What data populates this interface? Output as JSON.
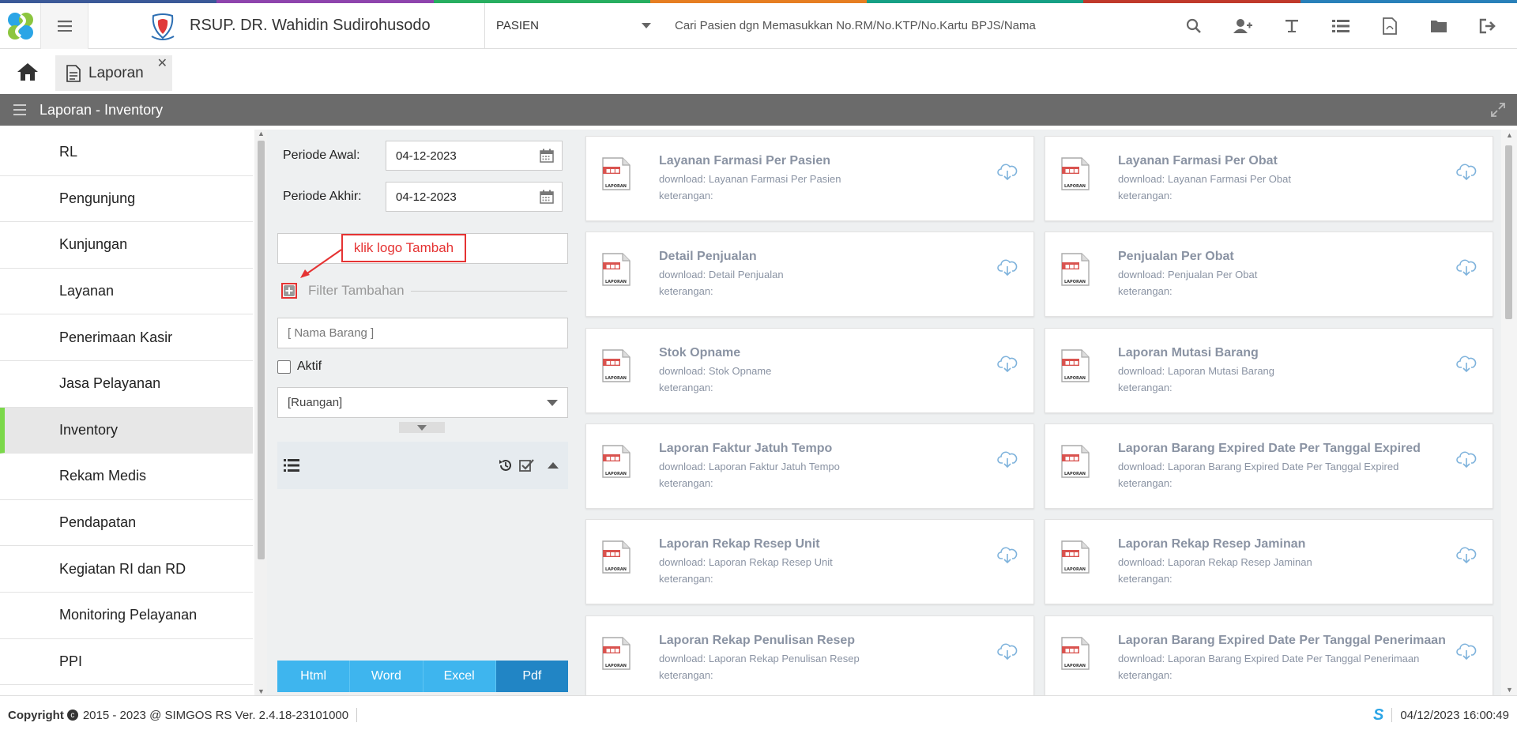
{
  "colors": {
    "accent": "#2185c5",
    "export_btn": "#3eb5ee",
    "titlebar": "#6b6b6b",
    "annotation": "#e53333",
    "active_indicator": "#7bd84a"
  },
  "header": {
    "hospital_name": "RSUP. DR. Wahidin Sudirohusodo",
    "patient_type": "PASIEN",
    "search_placeholder": "Cari Pasien dgn Memasukkan No.RM/No.KTP/No.Kartu BPJS/Nama",
    "icons": [
      "search-icon",
      "add-user-icon",
      "text-icon",
      "list-icon",
      "pdf-file-icon",
      "folder-icon",
      "logout-icon"
    ]
  },
  "tabs": {
    "active_label": "Laporan"
  },
  "titlebar": {
    "title": "Laporan - Inventory"
  },
  "sidebar": {
    "items": [
      {
        "label": "RL"
      },
      {
        "label": "Pengunjung"
      },
      {
        "label": "Kunjungan"
      },
      {
        "label": "Layanan"
      },
      {
        "label": "Penerimaan Kasir"
      },
      {
        "label": "Jasa Pelayanan"
      },
      {
        "label": "Inventory",
        "active": true
      },
      {
        "label": "Rekam Medis"
      },
      {
        "label": "Pendapatan"
      },
      {
        "label": "Kegiatan RI dan RD"
      },
      {
        "label": "Monitoring Pelayanan"
      },
      {
        "label": "PPI"
      }
    ]
  },
  "filter": {
    "periode_awal_label": "Periode Awal:",
    "periode_awal_value": "04-12-2023",
    "periode_akhir_label": "Periode Akhir:",
    "periode_akhir_value": "04-12-2023",
    "annotation_text": "klik logo Tambah",
    "filter_tambahan_label": "Filter Tambahan",
    "nama_barang_placeholder": "[ Nama Barang ]",
    "aktif_label": "Aktif",
    "ruangan_value": "[Ruangan]",
    "export_buttons": [
      "Html",
      "Word",
      "Excel",
      "Pdf"
    ]
  },
  "reports": [
    {
      "title": "Layanan Farmasi Per Pasien",
      "download": "download: Layanan Farmasi Per Pasien",
      "keterangan": "keterangan:"
    },
    {
      "title": "Layanan Farmasi Per Obat",
      "download": "download: Layanan Farmasi Per Obat",
      "keterangan": "keterangan:"
    },
    {
      "title": "Detail Penjualan",
      "download": "download: Detail Penjualan",
      "keterangan": "keterangan:"
    },
    {
      "title": "Penjualan Per Obat",
      "download": "download: Penjualan Per Obat",
      "keterangan": "keterangan:"
    },
    {
      "title": "Stok Opname",
      "download": "download: Stok Opname",
      "keterangan": "keterangan:"
    },
    {
      "title": "Laporan Mutasi Barang",
      "download": "download: Laporan Mutasi Barang",
      "keterangan": "keterangan:"
    },
    {
      "title": "Laporan Faktur Jatuh Tempo",
      "download": "download: Laporan Faktur Jatuh Tempo",
      "keterangan": "keterangan:"
    },
    {
      "title": "Laporan Barang Expired Date Per Tanggal Expired",
      "download": "download: Laporan Barang Expired Date Per Tanggal Expired",
      "keterangan": "keterangan:"
    },
    {
      "title": "Laporan Rekap Resep Unit",
      "download": "download: Laporan Rekap Resep Unit",
      "keterangan": "keterangan:"
    },
    {
      "title": "Laporan Rekap Resep Jaminan",
      "download": "download: Laporan Rekap Resep Jaminan",
      "keterangan": "keterangan:"
    },
    {
      "title": "Laporan Rekap Penulisan Resep",
      "download": "download: Laporan Rekap Penulisan Resep",
      "keterangan": "keterangan:"
    },
    {
      "title": "Laporan Barang Expired Date Per Tanggal Penerimaan",
      "download": "download: Laporan Barang Expired Date Per Tanggal Penerimaan",
      "keterangan": "keterangan:"
    }
  ],
  "report_icon_label": "LAPORAN",
  "footer": {
    "copyright_label": "Copyright",
    "copyright_text": "2015 - 2023 @ SIMGOS RS Ver. 2.4.18-23101000",
    "logo_text": "S",
    "datetime": "04/12/2023 16:00:49"
  }
}
